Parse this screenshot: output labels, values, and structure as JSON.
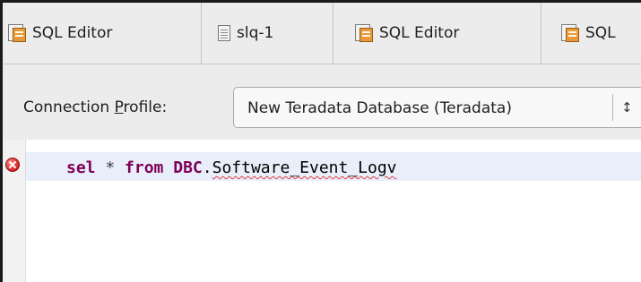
{
  "tabs": [
    {
      "label": "SQL Editor",
      "icon": "sql-editor-icon"
    },
    {
      "label": "slq-1",
      "icon": "file-icon"
    },
    {
      "label": "SQL Editor",
      "icon": "sql-editor-icon"
    },
    {
      "label": "SQL",
      "icon": "sql-editor-icon"
    }
  ],
  "connection": {
    "label_pre": "Connection ",
    "label_accel": "P",
    "label_post": "rofile:",
    "profile_value": "New Teradata Database (Teradata)"
  },
  "editor": {
    "error_marker": "error-icon",
    "tokens": {
      "kw_sel": "sel",
      "star": "*",
      "kw_from": "from",
      "db": "DBC",
      "dot": ".",
      "object": "Software_Event_Logv"
    }
  },
  "colors": {
    "keyword": "#7f0055",
    "current_line": "#e8eefa",
    "tab_bar": "#ececec",
    "error_squiggle": "#e04040"
  }
}
